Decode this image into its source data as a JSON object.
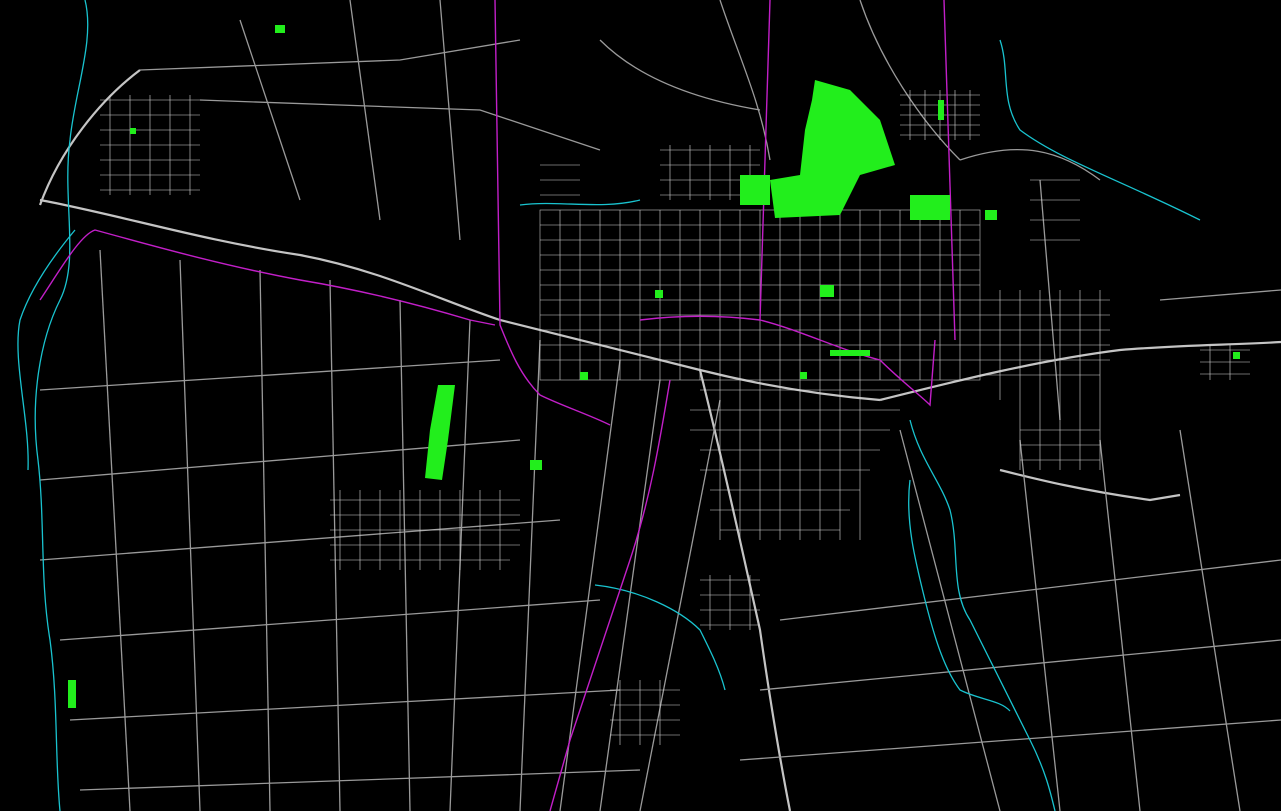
{
  "map": {
    "kind": "CAD street map (dark background)",
    "colors": {
      "background": "#000000",
      "roads": "#9a9a9a",
      "streets": "#d8d8d8",
      "rivers": "#19c3cf",
      "boundaries": "#c21fc8",
      "parks": "#22ee1c"
    },
    "layers": [
      "roads",
      "urban-street-grid",
      "rivers-canals",
      "municipal-boundaries",
      "green-areas"
    ]
  }
}
